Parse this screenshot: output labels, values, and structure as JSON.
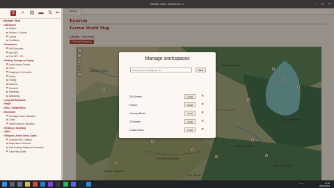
{
  "window": {
    "title": "Obsidian Vault - Obsidian v1.x.x"
  },
  "sidebar": {
    "toolbar_icons": [
      "vault-icon",
      "search-icon",
      "files-icon",
      "folder-icon",
      "sort-icon",
      "collapse-icon"
    ],
    "items": [
      {
        "label": "Obsidian Vault",
        "type": "heading"
      },
      {
        "label": "DM Screen",
        "type": "folder"
      },
      {
        "label": "Abilities",
        "type": "item"
      },
      {
        "label": "Actions in Combat",
        "type": "item"
      },
      {
        "label": "Checks",
        "type": "item"
      },
      {
        "label": "Conditions",
        "type": "item"
      },
      {
        "label": "Encounters",
        "type": "folder"
      },
      {
        "label": "Roll Encounter",
        "type": "item"
      },
      {
        "label": "Fast NPC",
        "type": "item"
      },
      {
        "label": "Fast NPC - FG",
        "type": "item"
      },
      {
        "label": "Healing, Damage and Dying",
        "type": "folder"
      },
      {
        "label": "Death Saving Throws",
        "type": "item"
      },
      {
        "label": "Cover",
        "type": "item"
      },
      {
        "label": "Dropping to 0 hit points",
        "type": "item"
      },
      {
        "label": "Falling",
        "type": "item"
      },
      {
        "label": "Healing",
        "type": "item"
      },
      {
        "label": "Madness",
        "type": "item"
      },
      {
        "label": "Sickened",
        "type": "item"
      },
      {
        "label": "Stabilizing",
        "type": "item"
      },
      {
        "label": "Suffocating",
        "type": "item"
      },
      {
        "label": "Long DM Workbook",
        "type": "folder"
      },
      {
        "label": "Magic",
        "type": "folder"
      },
      {
        "label": "Misc. Combat Rules",
        "type": "folder"
      },
      {
        "label": "Movement",
        "type": "folder"
      },
      {
        "label": "Six Magic Travel Calculator",
        "type": "item"
      },
      {
        "label": "Chase",
        "type": "item"
      },
      {
        "label": "Travel Distance Calculator",
        "type": "item"
      },
      {
        "label": "Resting & Travelling",
        "type": "folder"
      },
      {
        "label": "Skills",
        "type": "folder"
      },
      {
        "label": "Weapons, Armor, Items, Spells",
        "type": "folder"
      },
      {
        "label": "Generate NPC (Tables)",
        "type": "item"
      },
      {
        "label": "Magic Items Generator",
        "type": "item"
      },
      {
        "label": "Start Building Settlement Generator",
        "type": "item"
      },
      {
        "label": "Trade Help Sheet",
        "type": "item"
      }
    ]
  },
  "main": {
    "tab_label": "Faerun",
    "page_title": "Faerun",
    "section_title": "Faerun World Map",
    "climate_label": "Climate:",
    "climate_value": "Temperate",
    "tag": "#Climate/Temperate",
    "map_labels": [
      "Marsh of Tun",
      "Misty Forest",
      "Lake of Steam",
      "The Storm Horns",
      "Vilhon Reach",
      "Forest of Amtar",
      "Chondalwood",
      "The Shaar",
      "High Forest"
    ]
  },
  "modal": {
    "title": "Manage workspaces",
    "input_placeholder": "Save current workspace as...",
    "save_label": "Save",
    "load_label": "Load",
    "delete_glyph": "✕",
    "workspaces": [
      "DM Screen",
      "Faerun",
      "Journey Board",
      "3 Screens",
      "Chase Rules"
    ]
  },
  "taskbar": {
    "time": "11:32",
    "date": "08/02/2023",
    "app_icons": [
      "start-icon",
      "search-icon",
      "taskview-icon",
      "explorer-icon",
      "chrome-icon",
      "mail-icon",
      "obsidian-icon",
      "terminal-icon",
      "spotify-icon",
      "discord-icon",
      "steam-icon",
      "vscode-icon"
    ]
  },
  "colors": {
    "accent": "#a12b2b",
    "heading": "#8a1d1d",
    "map_forest": "#4d7a50",
    "map_plains": "#b8ae86"
  }
}
